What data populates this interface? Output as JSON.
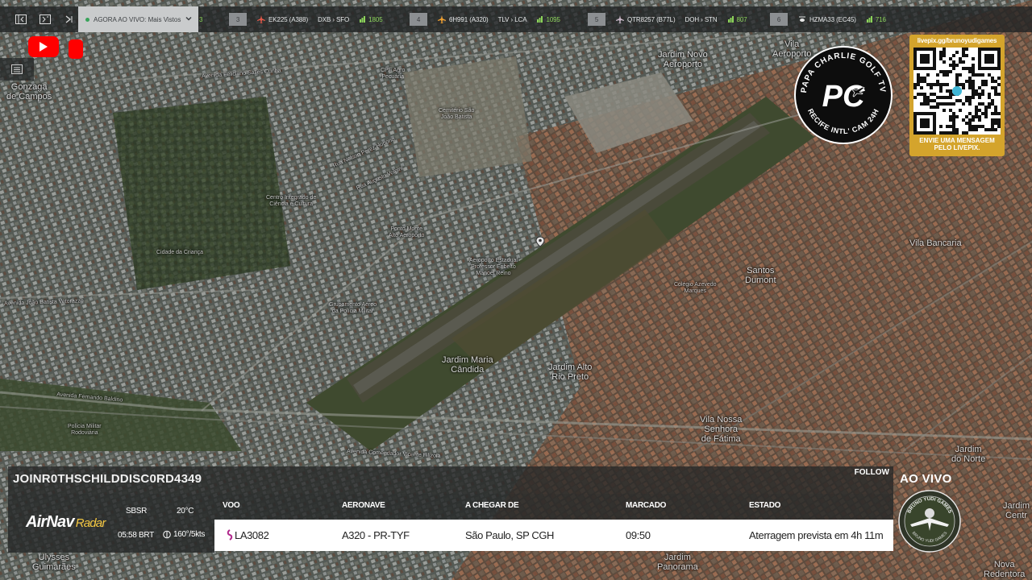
{
  "topbar": {
    "now_live": "AGORA AO VIVO: Mais Vistos",
    "cut_number": "3",
    "flights": [
      {
        "num": "3",
        "flight": "EK225 (A388)",
        "route": "DXB › SFO",
        "altitude": "1805",
        "color": "#e25a4a"
      },
      {
        "num": "4",
        "flight": "6H991 (A320)",
        "route": "TLV › LCA",
        "altitude": "1095",
        "color": "#f0a030"
      },
      {
        "num": "5",
        "flight": "QTR8257 (B77L)",
        "route": "DOH › STN",
        "altitude": "807",
        "color": "#c9b8c8"
      },
      {
        "num": "6",
        "flight": "HZMA33 (EC45)",
        "route": "",
        "altitude": "716",
        "color": "#e8e8e8"
      }
    ]
  },
  "map_labels": {
    "gonzaga": "Gonzaga\nde Campos",
    "vila_aeroporto": "Vila\nAeroporto",
    "jardim_novo_aeroporto": "Jardim Novo\nAeroporto",
    "cemiterio": "Cemitério São\nJoão Batista",
    "cpf_agro": "CPF Agro\nPecuária",
    "centro_integrado": "Centro Integrado de\nCiência e Cultura",
    "ponto_monte": "Ponto Monte\nAlto Aeroporto",
    "cidade_crianca": "Cidade da Criança",
    "aeroporto_estadual": "Aeroporto Estadual\nProfessor Eribelto\nManoel Reino",
    "vila_bancaria": "Vila Bancaria",
    "santos_dumont": "Santos\nDumont",
    "colegio": "Colégio Azevedo\nMarques",
    "grupamento": "Grupamento Aéreo\nda Polícia Militar",
    "jardim_maria_candida": "Jardim Maria\nCândida",
    "jardim_alto_rio_preto": "Jardim Alto\nRio Preto",
    "vila_nossa_senhora": "Vila Nossa\nSenhora\nde Fátima",
    "jardim_do_norte": "Jardim\ndo Norte",
    "jardim_centro": "Jardim\nCentr",
    "policia_militar": "Polícia Militar\nRodoviária",
    "ulysses": "Ulysses\nGuimarães",
    "jardim_panorama": "Jardim\nPanorama",
    "nova_redentora": "Nova\nRedentora",
    "av_feliciano": "Avenida Feliciano Salles Cunha",
    "av_joao_batista": "Avenida João Batista Vetorazzo",
    "av_fernando": "Avenida Fernando Baldino",
    "av_comendador": "Avenida Comendador Vicente Filizola",
    "rua_nelson": "Rua Nelson Perez Honorio",
    "rua_augusto": "Rua Augusto Volpini"
  },
  "brand": {
    "top_text": "PAPA CHARLIE GOLF TV",
    "bottom_text": "RECIFE INTL' CAM 24H",
    "monogram": "PC"
  },
  "qr": {
    "url": "livepix.gg/brunoyudigames",
    "message": "ENVIE UMA MENSAGEM\nPELO LIVEPIX."
  },
  "panel": {
    "join_text": "JOINR0THSCHILDDISC0RD4349",
    "follow": "FOLLOW",
    "airnav": "AirNav",
    "radar": "Radar",
    "weather": {
      "station": "SBSR",
      "temp": "20°C",
      "time": "05:58 BRT",
      "wind": "160°/5kts"
    },
    "columns": [
      "VOO",
      "AERONAVE",
      "A CHEGAR DE",
      "MARCADO",
      "ESTADO"
    ],
    "row": {
      "flight": "LA3082",
      "aircraft": "A320 - PR-TYF",
      "origin": "São Paulo, SP CGH",
      "scheduled": "09:50",
      "status": "Aterragem prevista em 4h 11m"
    }
  },
  "live": {
    "label": "AO VIVO",
    "badge_top": "BRUNO YUDI GAMES",
    "badge_bottom": "BRUNO YUDI GAMES"
  }
}
